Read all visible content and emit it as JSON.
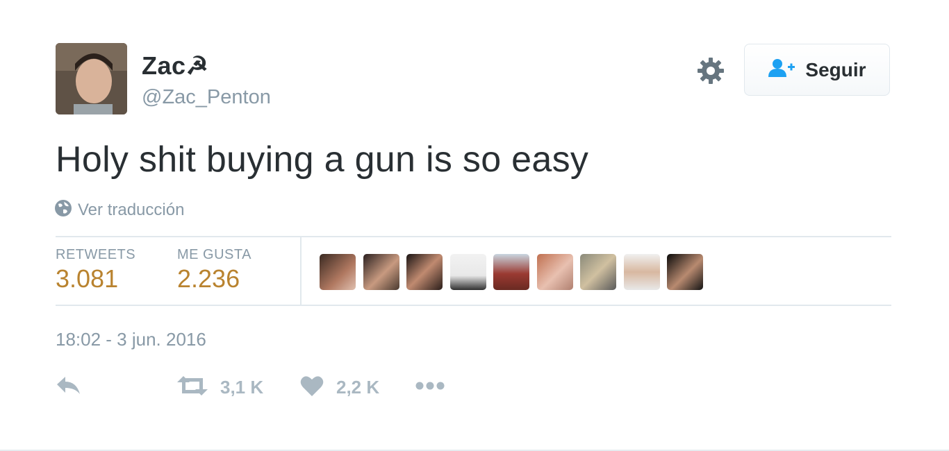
{
  "user": {
    "display_name": "Zac☭",
    "handle": "@Zac_Penton"
  },
  "follow_button": {
    "label": "Seguir"
  },
  "tweet": {
    "text": "Holy shit buying a gun is so easy",
    "translate_label": "Ver traducción",
    "timestamp": "18:02 - 3 jun. 2016"
  },
  "stats": {
    "retweets_label": "RETWEETS",
    "retweets_value": "3.081",
    "likes_label": "ME GUSTA",
    "likes_value": "2.236"
  },
  "actions": {
    "retweet_count": "3,1 K",
    "like_count": "2,2 K"
  },
  "icons": {
    "gear": "gear-icon",
    "follow": "add-person-icon",
    "globe": "globe-icon",
    "reply": "reply-icon",
    "retweet": "retweet-icon",
    "like": "heart-icon",
    "more": "more-icon"
  },
  "colors": {
    "stat_value": "#b9832f",
    "muted": "#8899a6",
    "accent": "#1da1f2"
  }
}
